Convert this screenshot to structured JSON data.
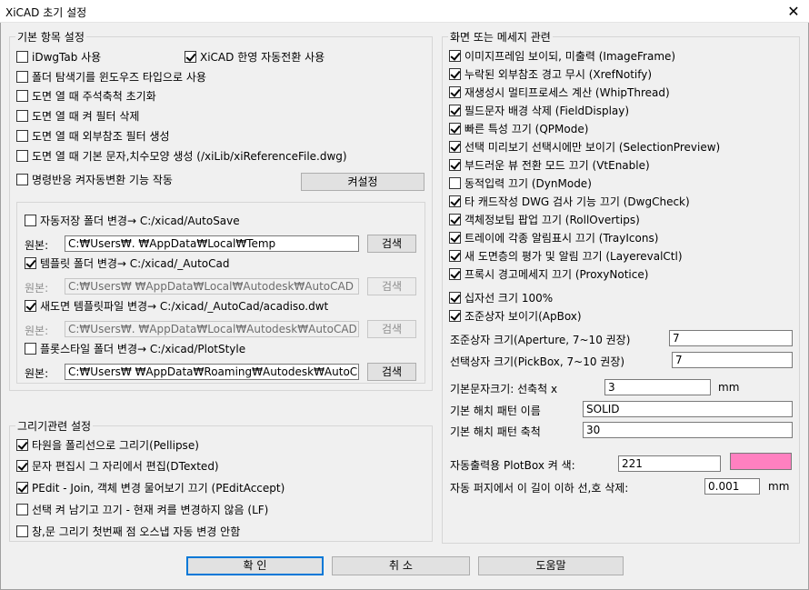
{
  "window": {
    "title": "XiCAD 초기 설정",
    "close_glyph": "✕"
  },
  "basic": {
    "legend": "기본 항목 설정",
    "checkboxes": [
      {
        "label": "iDwgTab 사용",
        "checked": false
      },
      {
        "label": "XiCAD 한영 자동전환 사용",
        "checked": true
      },
      {
        "label": "폴더 탐색기를 윈도우즈 타입으로 사용",
        "checked": false
      },
      {
        "label": "도면 열 때 주석축척 초기화",
        "checked": false
      },
      {
        "label": "도면 열 때 켜 필터 삭제",
        "checked": false
      },
      {
        "label": "도면 열 때 외부참조 필터 생성",
        "checked": false
      },
      {
        "label": "도면 열 때 기본 문자,치수모양 생성 (/xiLib/xiReferenceFile.dwg)",
        "checked": false
      },
      {
        "label": "명령반응 켜자동변환 기능 작동",
        "checked": false
      }
    ],
    "layer_settings_button": "켜설정"
  },
  "folders": {
    "autosave": {
      "label": "자동저장 폴더 변경→ C:/xicad/AutoSave",
      "checked": false
    },
    "source_label": "원본:",
    "autosave_path": "C:₩Users₩.        ₩AppData₩Local₩Temp",
    "template_folder": {
      "label": "템플릿 폴더 변경→ C:/xicad/_AutoCad",
      "checked": true
    },
    "template_path": "C:₩Users₩         ₩AppData₩Local₩Autodesk₩AutoCAD",
    "new_template": {
      "label": "새도면 템플릿파일 변경→ C:/xicad/_AutoCad/acadiso.dwt",
      "checked": true
    },
    "new_template_path": "C:₩Users₩.         ₩AppData₩Local₩Autodesk₩AutoCAD",
    "plotstyle": {
      "label": "플롯스타일 폴더 변경→ C:/xicad/PlotStyle",
      "checked": false
    },
    "plotstyle_path": "C:₩Users₩        ₩AppData₩Roaming₩Autodesk₩AutoC",
    "search_button": "검색"
  },
  "drawing": {
    "legend": "그리기관련 설정",
    "checkboxes": [
      {
        "label": "타원을 폴리선으로 그리기(Pellipse)",
        "checked": true
      },
      {
        "label": "문자 편집시 그 자리에서 편집(DTexted)",
        "checked": true
      },
      {
        "label": "PEdit - Join, 객체 변경 물어보기 끄기 (PEditAccept)",
        "checked": true
      },
      {
        "label": "선택 켜 남기고 끄기 - 현재 켜를 변경하지 않음 (LF)",
        "checked": false
      },
      {
        "label": "창,문 그리기 첫번째 점 오스냅 자동 변경 안함",
        "checked": false
      }
    ]
  },
  "display": {
    "legend": "화면 또는 메세지 관련",
    "checkboxes": [
      {
        "label": "이미지프레임 보이되, 미출력 (ImageFrame)",
        "checked": true
      },
      {
        "label": "누락된 외부참조 경고 무시 (XrefNotify)",
        "checked": true
      },
      {
        "label": "재생성시 멀티프로세스 계산 (WhipThread)",
        "checked": true
      },
      {
        "label": "필드문자 배경 삭제 (FieldDisplay)",
        "checked": true
      },
      {
        "label": "빠른 특성 끄기 (QPMode)",
        "checked": true
      },
      {
        "label": "선택 미리보기 선택시에만 보이기 (SelectionPreview)",
        "checked": true
      },
      {
        "label": "부드러운 뷰 전환 모드 끄기 (VtEnable)",
        "checked": true
      },
      {
        "label": "동적입력 끄기 (DynMode)",
        "checked": false
      },
      {
        "label": "타 캐드작성 DWG 검사 기능 끄기 (DwgCheck)",
        "checked": true
      },
      {
        "label": "객체정보팁 팝업 끄기 (RollOvertips)",
        "checked": true
      },
      {
        "label": "트레이에 각종 알림표시 끄기 (TrayIcons)",
        "checked": true
      },
      {
        "label": "새 도면층의 평가 및 알림 끄기 (LayerevalCtl)",
        "checked": true
      },
      {
        "label": "프록시 경고메세지 끄기 (ProxyNotice)",
        "checked": true
      }
    ],
    "crosshair": {
      "label": "십자선 크기 100%",
      "checked": true
    },
    "apbox": {
      "label": "조준상자 보이기(ApBox)",
      "checked": true
    },
    "aperture": {
      "label": "조준상자 크기(Aperture, 7~10 권장)",
      "value": "7"
    },
    "pickbox": {
      "label": "선택상자 크기(PickBox, 7~10 권장)",
      "value": "7"
    },
    "text_size": {
      "label": "기본문자크기: 선축척 x",
      "value": "3",
      "unit": "mm"
    },
    "hatch_pattern": {
      "label": "기본 해치 패턴 이름",
      "value": "SOLID"
    },
    "hatch_scale": {
      "label": "기본 해치 패턴 축척",
      "value": "30"
    },
    "plotbox": {
      "label": "자동출력용 PlotBox 켜 색:",
      "value": "221",
      "color": "#ff80c0"
    },
    "purge": {
      "label": "자동 퍼지에서 이 길이 이하 선,호 삭제:",
      "value": "0.001",
      "unit": "mm"
    }
  },
  "buttons": {
    "ok": "확 인",
    "cancel": "취 소",
    "help": "도움말"
  }
}
